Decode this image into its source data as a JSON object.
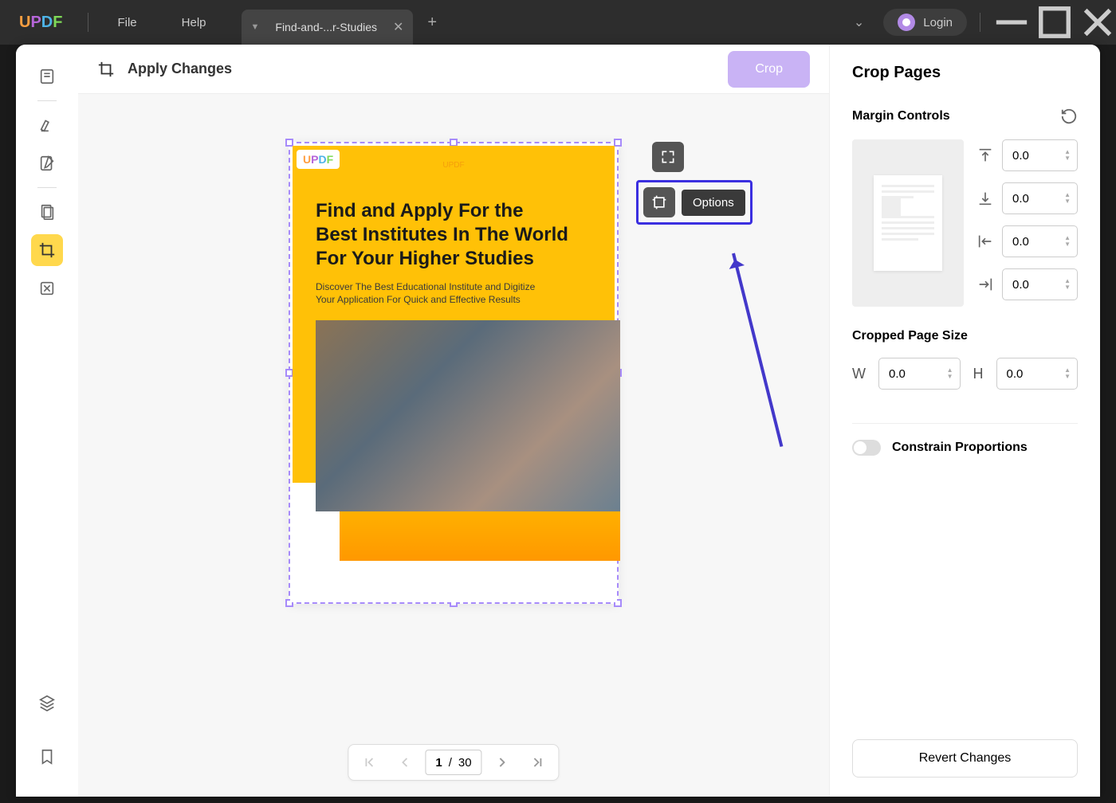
{
  "titlebar": {
    "file": "File",
    "help": "Help",
    "tab_title": "Find-and-...r-Studies",
    "login": "Login"
  },
  "toolbar": {
    "apply": "Apply Changes",
    "crop": "Crop"
  },
  "document": {
    "brand": "UPDF",
    "title": "Find and Apply For the Best Institutes In The World For Your Higher Studies",
    "subtitle": "Discover The Best Educational Institute and Digitize Your Application For Quick and Effective Results"
  },
  "options_tooltip": "Options",
  "pager": {
    "current": "1",
    "sep": "/",
    "total": "30"
  },
  "panel": {
    "title": "Crop Pages",
    "margin_label": "Margin Controls",
    "margins": {
      "top": "0.0",
      "bottom": "0.0",
      "left": "0.0",
      "right": "0.0"
    },
    "size_label": "Cropped Page Size",
    "w_label": "W",
    "w": "0.0",
    "h_label": "H",
    "h": "0.0",
    "constrain": "Constrain Proportions",
    "revert": "Revert Changes"
  }
}
